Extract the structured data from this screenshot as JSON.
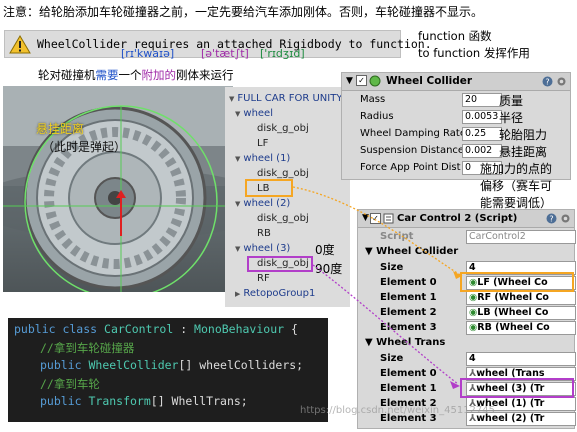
{
  "top_note": "注意：给轮胎添加车轮碰撞器之前，一定先要给汽车添加刚体。否则，车轮碰撞器不显示。",
  "warning": {
    "message": "WheelCollider requires an attached Rigidbody to function.",
    "phonetics": [
      "[rɪ'kwaɪə]",
      "[ə'tæt∫t]",
      "['rɪdʒɪd]"
    ]
  },
  "right_note": {
    "line1": "function 函数",
    "line2": "to function 发挥作用"
  },
  "sub_note": {
    "part1": "轮对碰撞机",
    "part2": "需要",
    "part3": "一个",
    "part4": "附加的",
    "part5": "刚体来运行"
  },
  "scene": {
    "caption1": "悬挂距离",
    "caption2": "（此时是弹起）"
  },
  "hierarchy": {
    "items": [
      {
        "label": "FULL CAR FOR UNITY"
      },
      {
        "label": "wheel"
      },
      {
        "label": "disk_g_obj"
      },
      {
        "label": "LF"
      },
      {
        "label": "wheel (1)"
      },
      {
        "label": "disk_g_obj"
      },
      {
        "label": "LB"
      },
      {
        "label": "wheel (2)"
      },
      {
        "label": "disk_g_obj"
      },
      {
        "label": "RB"
      },
      {
        "label": "wheel (3)"
      },
      {
        "label": "disk_g_obj"
      },
      {
        "label": "RF"
      },
      {
        "label": "RetopoGroup1"
      }
    ],
    "angle_note1": "0度",
    "angle_note2": "90度"
  },
  "wheel_collider": {
    "title": "Wheel Collider",
    "rows": [
      {
        "label": "Mass",
        "value": "20",
        "note": "质量"
      },
      {
        "label": "Radius",
        "value": "0.0053",
        "note": "半径"
      },
      {
        "label": "Wheel Damping Rate",
        "value": "0.25",
        "note": "轮胎阻力"
      },
      {
        "label": "Suspension Distance",
        "value": "0.002",
        "note": "悬挂距离"
      },
      {
        "label": "Force App Point Dist",
        "value": "0",
        "note": "施加力的点的"
      }
    ],
    "extra_note1": "偏移（赛车可",
    "extra_note2": "能需要调低）"
  },
  "car_control": {
    "title": "Car Control 2 (Script)",
    "script_label": "Script",
    "script_value": "CarControl2",
    "colliders_section": "Wheel Collider",
    "colliders_size_label": "Size",
    "colliders_size_value": "4",
    "colliders": [
      {
        "label": "Element 0",
        "value": "LF (Wheel Co"
      },
      {
        "label": "Element 1",
        "value": "RF (Wheel Co"
      },
      {
        "label": "Element 2",
        "value": "LB (Wheel Co"
      },
      {
        "label": "Element 3",
        "value": "RB (Wheel Co"
      }
    ],
    "trans_section": "Wheel Trans",
    "trans_size_label": "Size",
    "trans_size_value": "4",
    "trans": [
      {
        "label": "Element 0",
        "value": "wheel (Trans"
      },
      {
        "label": "Element 1",
        "value": "wheel (3) (Tr"
      },
      {
        "label": "Element 2",
        "value": "wheel (1) (Tr"
      },
      {
        "label": "Element 3",
        "value": "wheel (2) (Tr"
      }
    ]
  },
  "code": {
    "line1_kw": "public class ",
    "line1_ty": "CarControl",
    "line1_pl": " : ",
    "line1_ty2": "MonoBehaviour",
    "line1_end": " {",
    "line2": "//拿到车轮碰撞器",
    "line3_kw": "public ",
    "line3_ty": "WheelCollider",
    "line3_pl": "[] wheelColliders;",
    "line4": "//拿到车轮",
    "line5_kw": "public ",
    "line5_ty": "Transform",
    "line5_pl": "[] WhellTrans;"
  },
  "watermark": "https://blog.csdn.net/weixin_45112745"
}
